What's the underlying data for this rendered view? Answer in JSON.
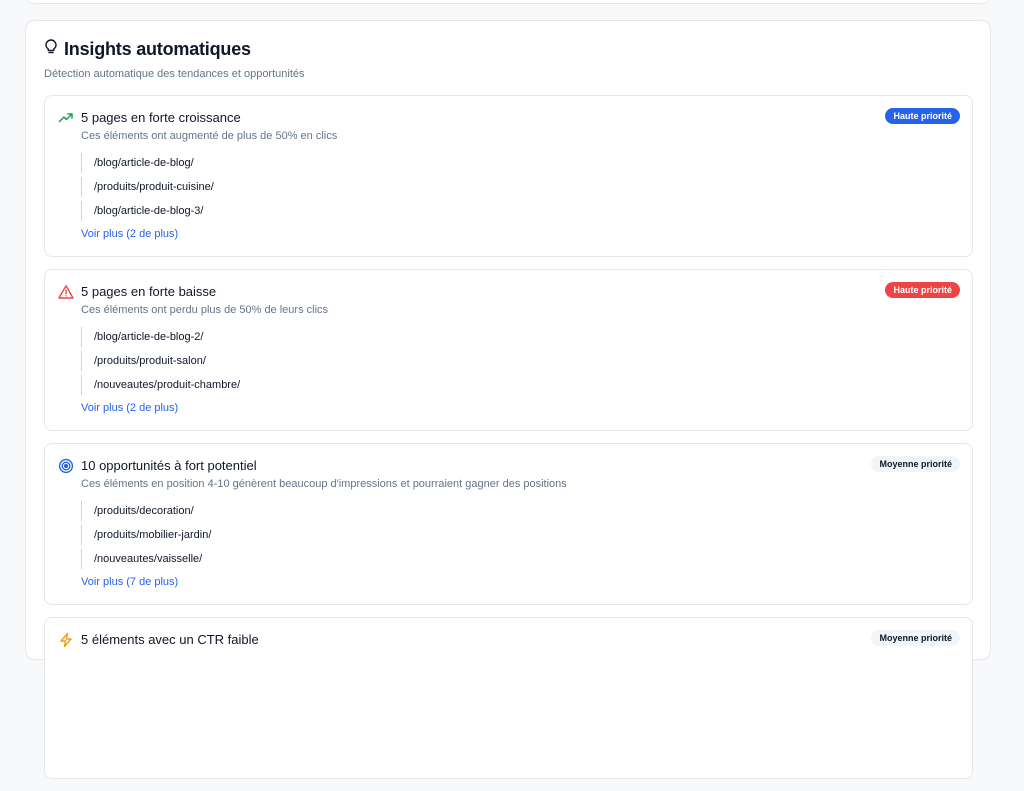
{
  "panel": {
    "title": "Insights automatiques",
    "subtitle": "Détection automatique des tendances et opportunités",
    "title_icon": "lightbulb-icon"
  },
  "colors": {
    "accent_blue": "#2563eb",
    "alert_red": "#ef4444",
    "growth_green": "#16a34a",
    "warning_amber": "#f59e0b"
  },
  "insights": [
    {
      "icon": "trending-up-icon",
      "title": "5 pages en forte croissance",
      "description": "Ces éléments ont augmenté de plus de 50% en clics",
      "priority": "Haute priorité",
      "items": [
        "/blog/article-de-blog/",
        "/produits/produit-cuisine/",
        "/blog/article-de-blog-3/"
      ],
      "more": "Voir plus (2 de plus)"
    },
    {
      "icon": "warning-triangle-icon",
      "title": "5 pages en forte baisse",
      "description": "Ces éléments ont perdu plus de 50% de leurs clics",
      "priority": "Haute priorité",
      "items": [
        "/blog/article-de-blog-2/",
        "/produits/produit-salon/",
        "/nouveautes/produit-chambre/"
      ],
      "more": "Voir plus (2 de plus)"
    },
    {
      "icon": "target-icon",
      "title": "10 opportunités à fort potentiel",
      "description": "Ces éléments en position 4-10 génèrent beaucoup d'impressions et pourraient gagner des positions",
      "priority": "Moyenne priorité",
      "items": [
        "/produits/decoration/",
        "/produits/mobilier-jardin/",
        "/nouveautes/vaisselle/"
      ],
      "more": "Voir plus (7 de plus)"
    },
    {
      "icon": "lightning-icon",
      "title": "5 éléments avec un CTR faible",
      "priority": "Moyenne priorité"
    }
  ]
}
